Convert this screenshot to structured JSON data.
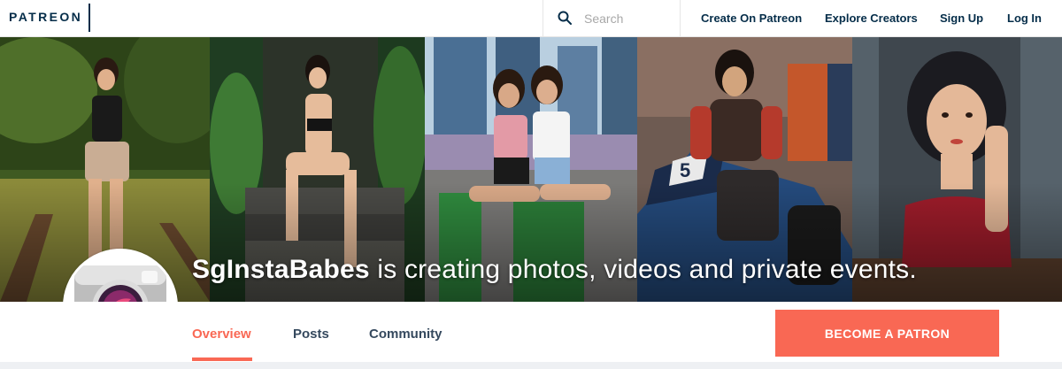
{
  "header": {
    "logo": "PATREON",
    "search_placeholder": "Search",
    "nav": {
      "create": "Create On Patreon",
      "explore": "Explore Creators",
      "signup": "Sign Up",
      "login": "Log In"
    }
  },
  "banner": {
    "creator_name": "SgInstaBabes",
    "tagline": " is creating photos, videos and private events."
  },
  "tabs": {
    "overview": "Overview",
    "posts": "Posts",
    "community": "Community"
  },
  "cta": {
    "label": "BECOME A PATRON"
  },
  "colors": {
    "brand_navy": "#052d49",
    "accent": "#f96854"
  },
  "icons": [
    "search-icon",
    "camera-logo-icon"
  ]
}
